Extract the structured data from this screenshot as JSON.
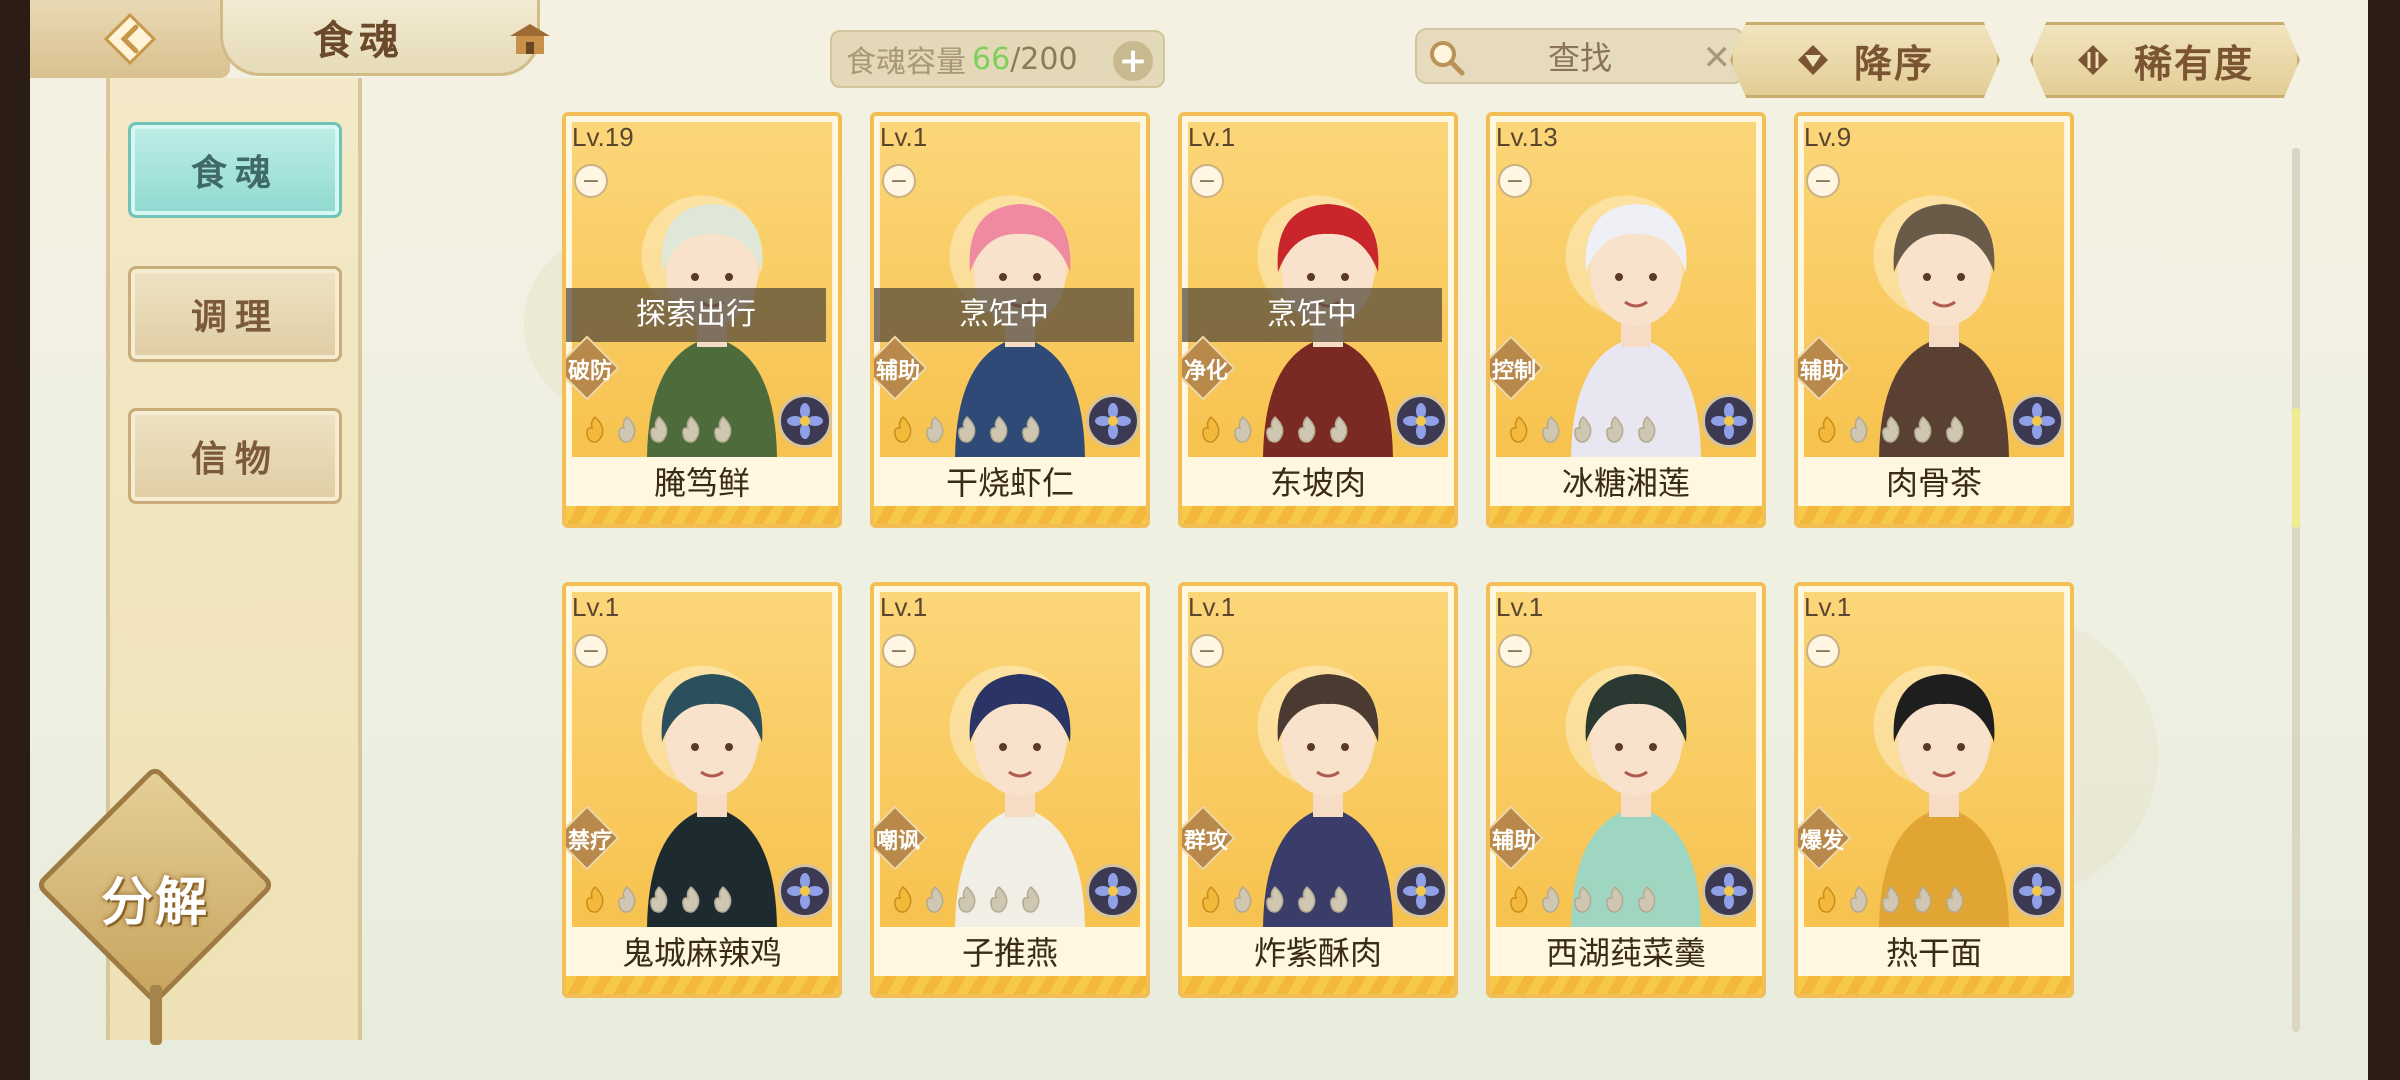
{
  "header": {
    "title": "食魂",
    "capacity_label": "食魂容量",
    "capacity_current": "66",
    "capacity_max": "/200",
    "capacity_add": "+",
    "search_label": "查找",
    "search_clear": "✕",
    "sort_order_label": "降序",
    "sort_key_label": "稀有度"
  },
  "sidebar": {
    "items": [
      {
        "label": "食魂",
        "active": true
      },
      {
        "label": "调理",
        "active": false
      },
      {
        "label": "信物",
        "active": false
      }
    ],
    "decompose_label": "分解"
  },
  "cards": [
    {
      "level": "Lv.19",
      "name": "腌笃鲜",
      "role": "破防",
      "status": "探索出行",
      "hair": "#dfe8d8",
      "outfit": "#4e6b3c"
    },
    {
      "level": "Lv.1",
      "name": "干烧虾仁",
      "role": "辅助",
      "status": "烹饪中",
      "hair": "#f08aa0",
      "outfit": "#2f4a76"
    },
    {
      "level": "Lv.1",
      "name": "东坡肉",
      "role": "净化",
      "status": "烹饪中",
      "hair": "#c8262a",
      "outfit": "#7a2a22"
    },
    {
      "level": "Lv.13",
      "name": "冰糖湘莲",
      "role": "控制",
      "status": "",
      "hair": "#eef0f6",
      "outfit": "#e8e6f0"
    },
    {
      "level": "Lv.9",
      "name": "肉骨茶",
      "role": "辅助",
      "status": "",
      "hair": "#6a5a48",
      "outfit": "#5a4032"
    },
    {
      "level": "Lv.1",
      "name": "鬼城麻辣鸡",
      "role": "禁疗",
      "status": "",
      "hair": "#2c4f5e",
      "outfit": "#1d2a2e"
    },
    {
      "level": "Lv.1",
      "name": "子推燕",
      "role": "嘲讽",
      "status": "",
      "hair": "#2a3566",
      "outfit": "#f1eee6"
    },
    {
      "level": "Lv.1",
      "name": "炸紫酥肉",
      "role": "群攻",
      "status": "",
      "hair": "#4a3a32",
      "outfit": "#3a3c6a"
    },
    {
      "level": "Lv.1",
      "name": "西湖莼菜羹",
      "role": "辅助",
      "status": "",
      "hair": "#2a3a32",
      "outfit": "#9fd6c2"
    },
    {
      "level": "Lv.1",
      "name": "热干面",
      "role": "爆发",
      "status": "",
      "hair": "#1e1e1e",
      "outfit": "#e0a532"
    }
  ],
  "colors": {
    "card_border": "#f2be55",
    "active_tab": "#8fd9d0",
    "capacity_current": "#7fcf5a"
  }
}
